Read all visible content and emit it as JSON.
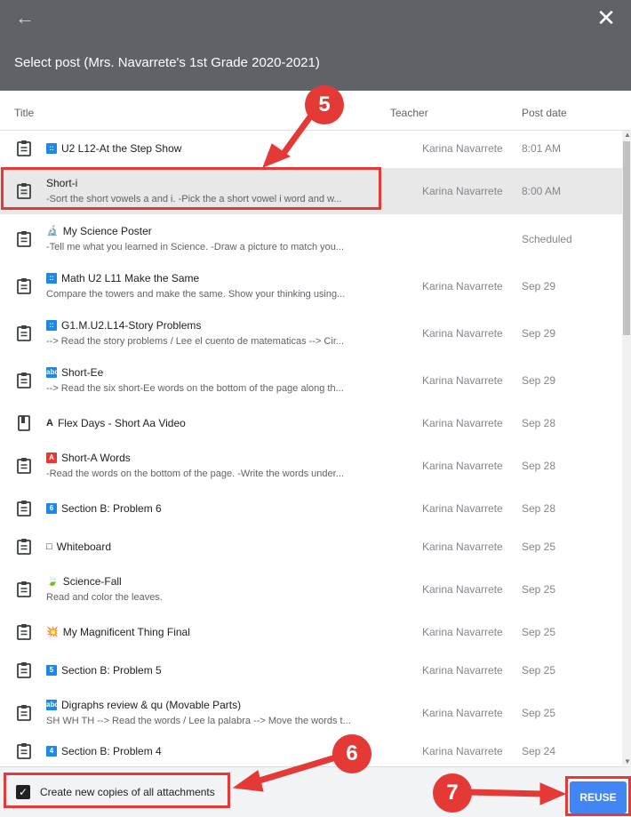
{
  "dialog": {
    "title": "Select post (Mrs. Navarrete's 1st Grade 2020-2021)",
    "back_icon": "arrow-back-icon",
    "close_icon": "close-icon"
  },
  "columns": {
    "title": "Title",
    "teacher": "Teacher",
    "date": "Post date"
  },
  "posts": [
    {
      "icon": "assignment-icon",
      "badge": "::",
      "badge_color": "#1e88e5",
      "title": "U2 L12-At the Step Show",
      "subtitle": "",
      "teacher": "Karina Navarrete",
      "date": "8:01 AM"
    },
    {
      "icon": "assignment-icon",
      "badge": "",
      "badge_color": "",
      "title": "Short-i",
      "subtitle": "-Sort the short vowels a and i. -Pick the a short vowel i word and w...",
      "teacher": "Karina Navarrete",
      "date": "8:00 AM"
    },
    {
      "icon": "assignment-icon",
      "badge": "🔬",
      "badge_color": "",
      "title": "My Science Poster",
      "subtitle": "-Tell me what you learned in Science. -Draw a picture to match you...",
      "teacher": "",
      "date": "Scheduled"
    },
    {
      "icon": "assignment-icon",
      "badge": "::",
      "badge_color": "#1e88e5",
      "title": "Math U2 L11 Make the Same",
      "subtitle": "Compare the towers and make the same. Show your thinking using...",
      "teacher": "Karina Navarrete",
      "date": "Sep 29"
    },
    {
      "icon": "assignment-icon",
      "badge": "::",
      "badge_color": "#1e88e5",
      "title": "G1.M.U2.L14-Story Problems",
      "subtitle": "--> Read the story problems / Lee el cuento de matematicas --> Cir...",
      "teacher": "Karina Navarrete",
      "date": "Sep 29"
    },
    {
      "icon": "assignment-icon",
      "badge": "abc",
      "badge_color": "#1e88e5",
      "title": "Short-Ee",
      "subtitle": "--> Read the six short-Ee words on the bottom of the page along th...",
      "teacher": "Karina Navarrete",
      "date": "Sep 29"
    },
    {
      "icon": "material-icon",
      "badge": "A",
      "badge_color": "",
      "title": "Flex Days - Short Aa Video",
      "subtitle": "",
      "teacher": "Karina Navarrete",
      "date": "Sep 28"
    },
    {
      "icon": "assignment-icon",
      "badge": "A",
      "badge_color": "#e53935",
      "title": "Short-A Words",
      "subtitle": "-Read the words on the bottom of the page. -Write the words under...",
      "teacher": "Karina Navarrete",
      "date": "Sep 28"
    },
    {
      "icon": "assignment-icon",
      "badge": "6",
      "badge_color": "#1e88e5",
      "title": "Section B: Problem 6",
      "subtitle": "",
      "teacher": "Karina Navarrete",
      "date": "Sep 28"
    },
    {
      "icon": "assignment-icon",
      "badge": "□",
      "badge_color": "",
      "title": "Whiteboard",
      "subtitle": "",
      "teacher": "Karina Navarrete",
      "date": "Sep 25"
    },
    {
      "icon": "assignment-icon",
      "badge": "🍃",
      "badge_color": "",
      "title": "Science-Fall",
      "subtitle": "Read and color the leaves.",
      "teacher": "Karina Navarrete",
      "date": "Sep 25"
    },
    {
      "icon": "assignment-icon",
      "badge": "💥",
      "badge_color": "",
      "title": "My Magnificent Thing Final",
      "subtitle": "",
      "teacher": "Karina Navarrete",
      "date": "Sep 25"
    },
    {
      "icon": "assignment-icon",
      "badge": "5",
      "badge_color": "#1e88e5",
      "title": "Section B: Problem 5",
      "subtitle": "",
      "teacher": "Karina Navarrete",
      "date": "Sep 25"
    },
    {
      "icon": "assignment-icon",
      "badge": "abc",
      "badge_color": "#1e88e5",
      "title": "Digraphs review & qu (Movable Parts)",
      "subtitle": "SH WH TH --> Read the words / Lee la palabra --> Move the words t...",
      "teacher": "Karina Navarrete",
      "date": "Sep 25"
    },
    {
      "icon": "assignment-icon",
      "badge": "4",
      "badge_color": "#1e88e5",
      "title": "Section B: Problem 4",
      "subtitle": "",
      "teacher": "Karina Navarrete",
      "date": "Sep 24"
    }
  ],
  "footer": {
    "checkbox_label": "Create new copies of all attachments",
    "checkbox_checked": true,
    "reuse_label": "REUSE"
  },
  "annotations": {
    "step_5": "5",
    "step_6": "6",
    "step_7": "7",
    "color": "#e53935"
  }
}
